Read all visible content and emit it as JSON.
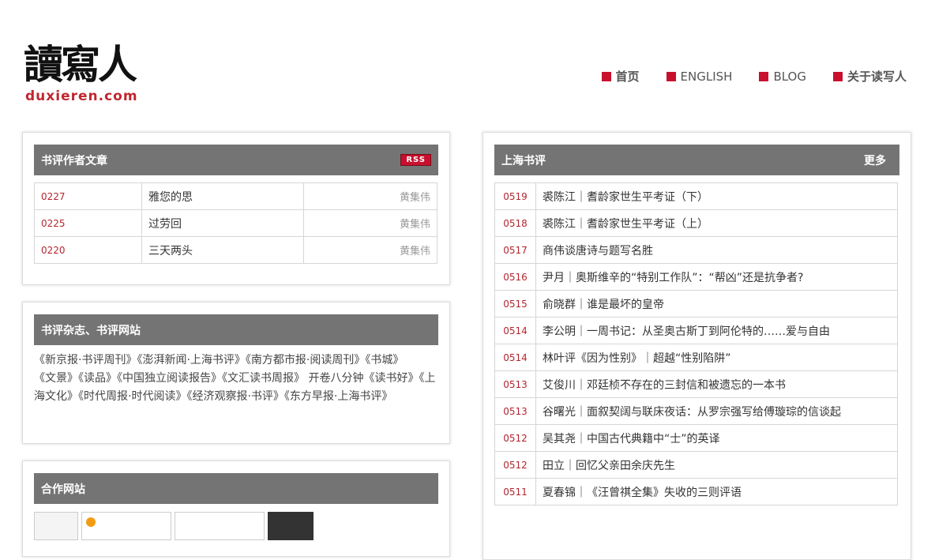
{
  "site": {
    "logo_cn": "讀寫人",
    "logo_en": "duxieren.com"
  },
  "nav": [
    {
      "label": "首页"
    },
    {
      "label": "ENGLISH"
    },
    {
      "label": "BLOG"
    },
    {
      "label": "关于读写人"
    }
  ],
  "left_panel": {
    "title": "书评作者文章",
    "rss_label": "RSS",
    "rows": [
      {
        "date": "0227",
        "title": "雅您的思",
        "author": "黄集伟"
      },
      {
        "date": "0225",
        "title": "过劳回",
        "author": "黄集伟"
      },
      {
        "date": "0220",
        "title": "三天两头",
        "author": "黄集伟"
      }
    ]
  },
  "mag_panel": {
    "title": "书评杂志、书评网站",
    "items": [
      "《新京报·书评周刊》",
      "《澎湃新闻·上海书评》",
      "《南方都市报·阅读周刊》",
      "《书城》",
      "《文景》",
      "《读品》",
      "《中国独立阅读报告》",
      "《文汇读书周报》",
      "开卷八分钟",
      "《读书好》",
      "《上海文化》",
      "《时代周报·时代阅读》",
      "《经济观察报·书评》",
      "《东方早报·上海书评》"
    ]
  },
  "partner_panel": {
    "title": "合作网站"
  },
  "right_panel": {
    "title": "上海书评",
    "more_label": "更多",
    "rows": [
      {
        "date": "0519",
        "title": "裘陈江｜耆龄家世生平考证（下）"
      },
      {
        "date": "0518",
        "title": "裘陈江｜耆龄家世生平考证（上）"
      },
      {
        "date": "0517",
        "title": "商伟谈唐诗与题写名胜"
      },
      {
        "date": "0516",
        "title": "尹月｜奥斯维辛的“特别工作队”：“帮凶”还是抗争者?"
      },
      {
        "date": "0515",
        "title": "俞晓群｜谁是最坏的皇帝"
      },
      {
        "date": "0514",
        "title": "李公明｜一周书记：从圣奥古斯丁到阿伦特的……爱与自由"
      },
      {
        "date": "0514",
        "title": "林叶评《因为性别》｜超越“性别陷阱”"
      },
      {
        "date": "0513",
        "title": "艾俊川｜邓廷桢不存在的三封信和被遗忘的一本书"
      },
      {
        "date": "0513",
        "title": "谷曙光｜面叙契阔与联床夜话：从罗宗强写给傅璇琮的信谈起"
      },
      {
        "date": "0512",
        "title": "吴其尧｜中国古代典籍中“士”的英译"
      },
      {
        "date": "0512",
        "title": "田立｜回忆父亲田余庆先生"
      },
      {
        "date": "0511",
        "title": "夏春锦｜《汪曾祺全集》失收的三则评语"
      }
    ]
  }
}
